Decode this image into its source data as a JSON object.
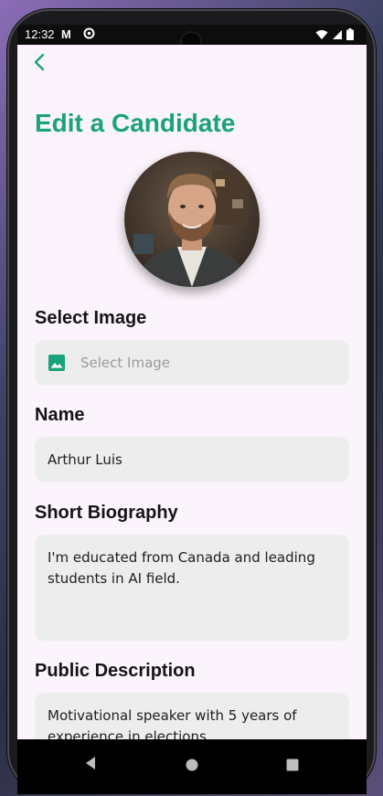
{
  "status_bar": {
    "time": "12:32",
    "mail_icon": "M",
    "icons": [
      "gmail-icon",
      "sync-icon",
      "wifi-icon",
      "signal-icon",
      "battery-icon"
    ]
  },
  "header": {
    "title": "Edit a Candidate",
    "back_icon": "chevron-left-icon",
    "accent_color": "#1aa37a"
  },
  "form": {
    "image": {
      "label": "Select Image",
      "placeholder": "Select Image",
      "icon": "image-icon"
    },
    "name": {
      "label": "Name",
      "value": "Arthur Luis"
    },
    "short_biography": {
      "label": "Short Biography",
      "value": "I'm educated from Canada and leading students in AI field."
    },
    "public_description": {
      "label": "Public Description",
      "value": "Motivational speaker with 5 years of experience in elections."
    }
  },
  "nav_bar": {
    "buttons": [
      "back-triangle-icon",
      "home-circle-icon",
      "recents-square-icon"
    ]
  }
}
